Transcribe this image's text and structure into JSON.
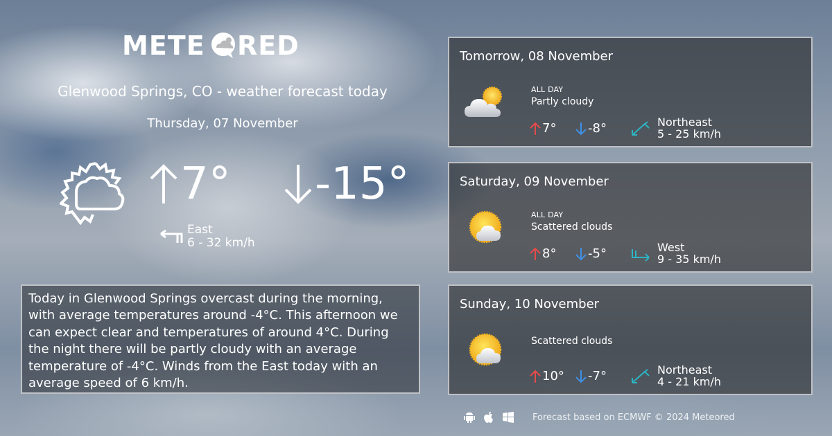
{
  "brand": {
    "logo_text": "METEORED"
  },
  "header": {
    "title": "Glenwood Springs, CO - weather forecast today",
    "date": "Thursday, 07 November"
  },
  "today": {
    "icon": "partly-cloudy-outline-icon",
    "max_temp": "7°",
    "min_temp": "-15°",
    "wind": {
      "direction": "East",
      "speed": "6 - 32 km/h",
      "icon": "wind-east-icon"
    }
  },
  "summary": {
    "text": "Today in Glenwood Springs overcast during the morning, with average temperatures around -4°C. This afternoon we can expect clear and temperatures of around 4°C. During the night there will be partly cloudy with an average temperature of -4°C. Winds from the East today with an average speed of 6 km/h."
  },
  "forecast": [
    {
      "date": "Tomorrow, 08 November",
      "period": "ALL DAY",
      "condition": "Partly cloudy",
      "icon": "partly-cloudy-icon",
      "max": "7°",
      "min": "-8°",
      "wind_direction": "Northeast",
      "wind_speed": "5 - 25 km/h",
      "wind_icon": "wind-northeast-icon"
    },
    {
      "date": "Saturday, 09 November",
      "period": "ALL DAY",
      "condition": "Scattered clouds",
      "icon": "sun-scattered-clouds-icon",
      "max": "8°",
      "min": "-5°",
      "wind_direction": "West",
      "wind_speed": "9 - 35 km/h",
      "wind_icon": "wind-west-icon"
    },
    {
      "date": "Sunday, 10 November",
      "period": "",
      "condition": "Scattered clouds",
      "icon": "sun-scattered-clouds-icon",
      "max": "10°",
      "min": "-7°",
      "wind_direction": "Northeast",
      "wind_speed": "4 - 21 km/h",
      "wind_icon": "wind-northeast-icon"
    }
  ],
  "footer": {
    "platforms": [
      "android-icon",
      "apple-icon",
      "windows-icon"
    ],
    "credit": "Forecast based on ECMWF © 2024 Meteored"
  },
  "colors": {
    "max_arrow": "#e84a4a",
    "min_arrow": "#3f8fe6",
    "wind_arrow": "#2bb5c4",
    "sun": "#f7b51f",
    "card_border": "#d2d4d7"
  }
}
